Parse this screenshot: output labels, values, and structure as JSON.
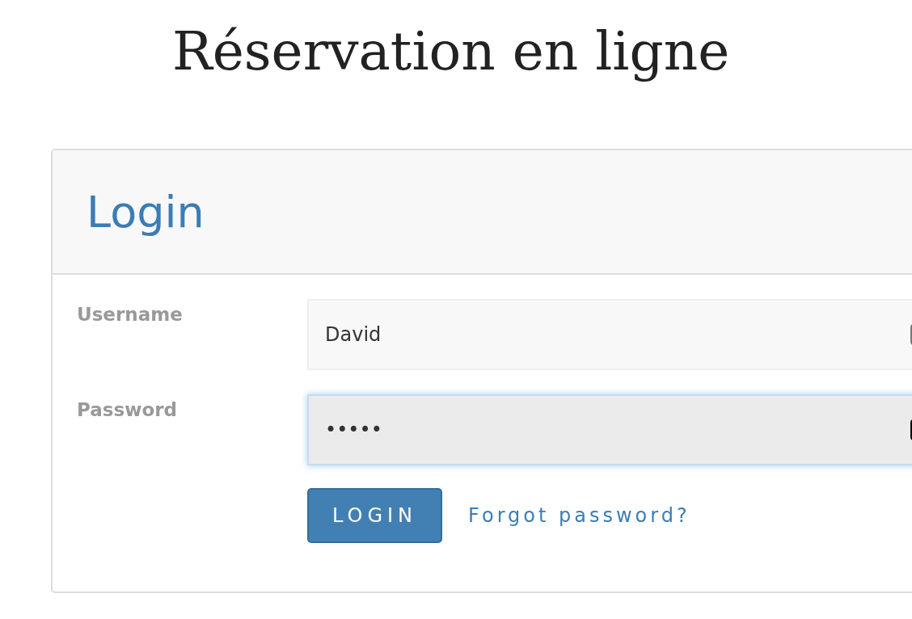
{
  "page": {
    "title": "Réservation en ligne"
  },
  "login_panel": {
    "heading": "Login",
    "fields": [
      {
        "label": "Username",
        "value": "David",
        "focused": false
      },
      {
        "label": "Password",
        "value": "•••••",
        "focused": true
      }
    ],
    "submit_button": "LOGIN",
    "forgot_link": "Forgot password?"
  }
}
